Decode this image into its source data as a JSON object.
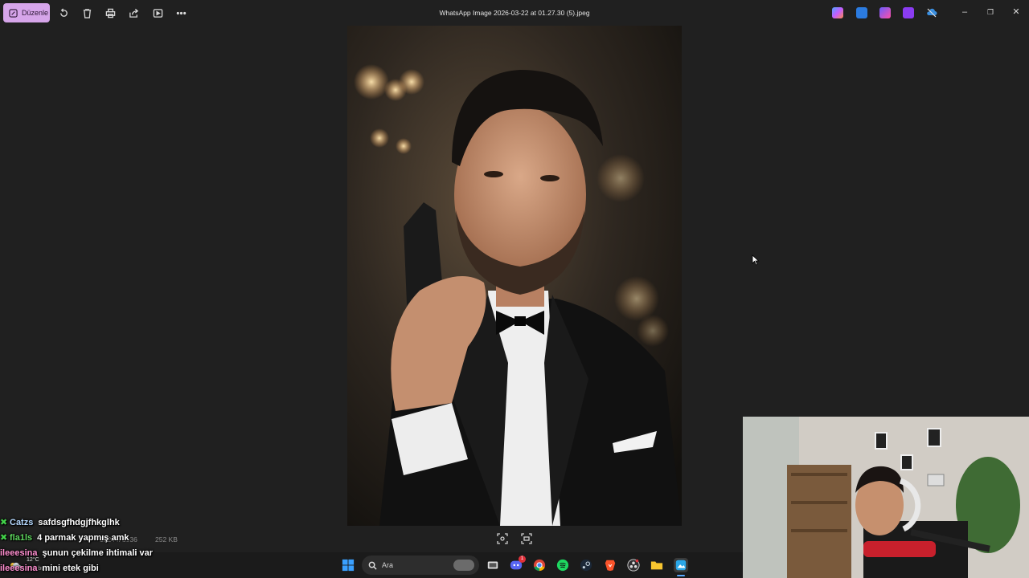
{
  "toolbar": {
    "edit_label": "Düzenle",
    "tools": [
      "rotate-icon",
      "delete-icon",
      "print-icon",
      "share-icon",
      "slideshow-icon",
      "more-icon"
    ]
  },
  "window": {
    "title": "WhatsApp Image 2026-03-22 at 01.27.30 (5).jpeg"
  },
  "status": {
    "dimensions": "1024 x 1536",
    "size": "252 KB"
  },
  "taskbar": {
    "search_placeholder": "Ara",
    "weather_temp": "12°C",
    "weather_condition": "Çok bulutlu",
    "discord_badge": "1"
  },
  "chat": [
    {
      "user": "Catzs",
      "color": "#b6d9ff",
      "message": "safdsgfhdgjfhkglhk"
    },
    {
      "user": "fla1ls",
      "color": "#5ed65e",
      "message": "4 parmak yapmış amk"
    },
    {
      "user": "ileeesina",
      "color": "#ff8fd0",
      "message": "şunun çekilme ihtimali var"
    },
    {
      "user": "ileeesina",
      "color": "#ff8fd0",
      "message": "mini etek gibi"
    }
  ],
  "colors": {
    "accent": "#d6a5ea",
    "background": "#202020",
    "taskbar": "#1b1b1b"
  }
}
